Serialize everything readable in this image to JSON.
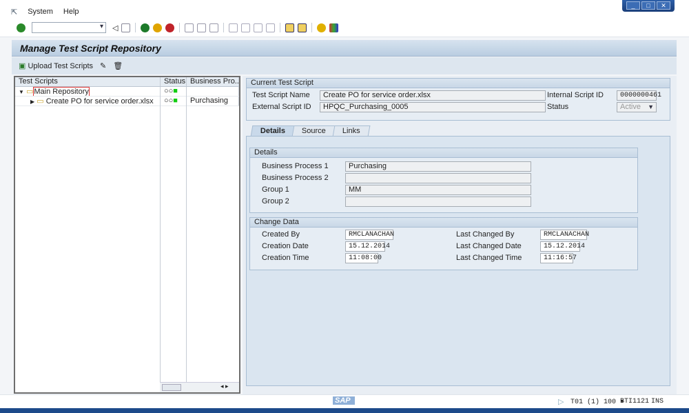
{
  "menu": {
    "items": [
      "System",
      "Help"
    ]
  },
  "title": "Manage Test Script Repository",
  "app_toolbar": {
    "upload": "Upload Test Scripts"
  },
  "tree": {
    "headers": [
      "Test Scripts",
      "Status",
      "Business Pro..."
    ],
    "rows": [
      {
        "name": "Main Repository",
        "process": ""
      },
      {
        "name": "Create PO for service order.xlsx",
        "process": "Purchasing"
      }
    ]
  },
  "current": {
    "group": "Current Test Script",
    "name_label": "Test Script Name",
    "name": "Create PO for service order.xlsx",
    "ext_label": "External Script ID",
    "ext": "HPQC_Purchasing_0005",
    "int_label": "Internal Script ID",
    "int": "0000000461",
    "status_label": "Status",
    "status": "Active"
  },
  "tabs": [
    "Details",
    "Source",
    "Links"
  ],
  "details": {
    "group": "Details",
    "bp1_label": "Business Process 1",
    "bp1": "Purchasing",
    "bp2_label": "Business Process 2",
    "bp2": "",
    "g1_label": "Group 1",
    "g1": "MM",
    "g2_label": "Group 2",
    "g2": ""
  },
  "change": {
    "group": "Change Data",
    "cby_label": "Created By",
    "cby": "RMCLANACHAN",
    "cdate_label": "Creation Date",
    "cdate": "15.12.2014",
    "ctime_label": "Creation Time",
    "ctime": "11:08:00",
    "lby_label": "Last Changed By",
    "lby": "RMCLANACHAN",
    "ldate_label": "Last Changed Date",
    "ldate": "15.12.2014",
    "ltime_label": "Last Changed Time",
    "ltime": "11:16:57"
  },
  "statusbar": {
    "logo": "SAP",
    "system": "T01 (1) 100",
    "server": "BTI1121",
    "mode": "INS"
  }
}
